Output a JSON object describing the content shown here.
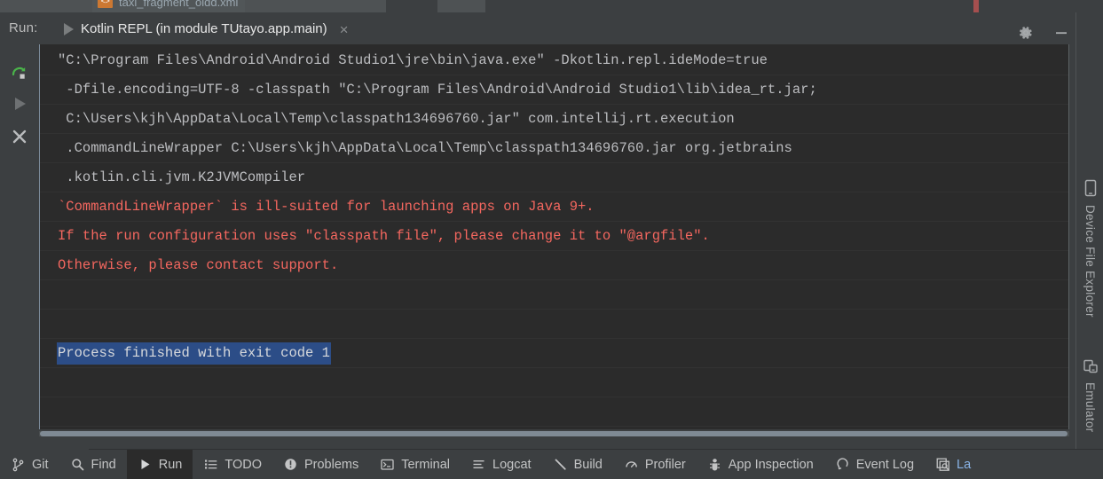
{
  "editor_tabs": [
    {
      "label": "taxi_fragment_oldd.xml",
      "icon": "xml-file-icon",
      "icon_text": "<>"
    }
  ],
  "run_window": {
    "label": "Run:",
    "tab_title": "Kotlin REPL (in module TUtayo.app.main)",
    "tab_close": "×",
    "run_icon": "play-icon",
    "settings_icon": "gear-icon",
    "minimize_icon": "minimize-icon"
  },
  "gutter": {
    "rerun": "rerun-icon",
    "resume": "resume-icon",
    "stop": "stop-icon"
  },
  "console": {
    "lines": [
      {
        "text": "\"C:\\Program Files\\Android\\Android Studio1\\jre\\bin\\java.exe\" -Dkotlin.repl.ideMode=true",
        "type": "out",
        "indent": 0
      },
      {
        "text": " -Dfile.encoding=UTF-8 -classpath \"C:\\Program Files\\Android\\Android Studio1\\lib\\idea_rt.jar;",
        "type": "out",
        "indent": 0
      },
      {
        "text": " C:\\Users\\kjh\\AppData\\Local\\Temp\\classpath134696760.jar\" com.intellij.rt.execution",
        "type": "out",
        "indent": 0
      },
      {
        "text": " .CommandLineWrapper C:\\Users\\kjh\\AppData\\Local\\Temp\\classpath134696760.jar org.jetbrains",
        "type": "out",
        "indent": 0
      },
      {
        "text": " .kotlin.cli.jvm.K2JVMCompiler",
        "type": "out",
        "indent": 0
      },
      {
        "text": "`CommandLineWrapper` is ill-suited for launching apps on Java 9+.",
        "type": "err",
        "indent": 0
      },
      {
        "text": "If the run configuration uses \"classpath file\", please change it to \"@argfile\".",
        "type": "err",
        "indent": 0
      },
      {
        "text": "Otherwise, please contact support.",
        "type": "err",
        "indent": 0
      },
      {
        "text": "",
        "type": "blank",
        "indent": 0
      },
      {
        "text": "",
        "type": "blank",
        "indent": 0
      },
      {
        "text": "Process finished with exit code 1",
        "type": "out",
        "indent": 0,
        "selected": true
      },
      {
        "text": "",
        "type": "blank",
        "indent": 0
      },
      {
        "text": "",
        "type": "blank",
        "indent": 0
      },
      {
        "text": "",
        "type": "blank",
        "indent": 0
      }
    ],
    "selection_color": "#2c4d87",
    "error_color": "#f4675f",
    "text_color": "#bcbdc0",
    "background": "#2b2b2b"
  },
  "right_rail": [
    {
      "label": "Device File Explorer",
      "icon": "device-icon"
    },
    {
      "label": "Emulator",
      "icon": "emulator-icon"
    }
  ],
  "statusbar": {
    "items": [
      {
        "label": "Git",
        "icon": "git-branch-icon",
        "active": false
      },
      {
        "label": "Find",
        "icon": "search-icon",
        "active": false
      },
      {
        "label": "Run",
        "icon": "play-icon",
        "active": true
      },
      {
        "label": "TODO",
        "icon": "todo-list-icon",
        "active": false
      },
      {
        "label": "Problems",
        "icon": "warning-icon",
        "active": false
      },
      {
        "label": "Terminal",
        "icon": "terminal-icon",
        "active": false
      },
      {
        "label": "Logcat",
        "icon": "logcat-icon",
        "active": false
      },
      {
        "label": "Build",
        "icon": "hammer-icon",
        "active": false
      },
      {
        "label": "Profiler",
        "icon": "profiler-icon",
        "active": false
      },
      {
        "label": "App Inspection",
        "icon": "app-inspection-icon",
        "active": false
      },
      {
        "label": "Event Log",
        "icon": "event-log-icon",
        "active": false
      },
      {
        "label": "La",
        "icon": "layout-inspector-icon",
        "active": false,
        "truncated": true
      }
    ]
  },
  "colors": {
    "chrome": "#3c3f41",
    "console_bg": "#2b2b2b",
    "accent_blue": "#3a87e8",
    "selection": "#2c4d87",
    "error_red": "#f4675f",
    "xml_icon": "#cc7832"
  }
}
